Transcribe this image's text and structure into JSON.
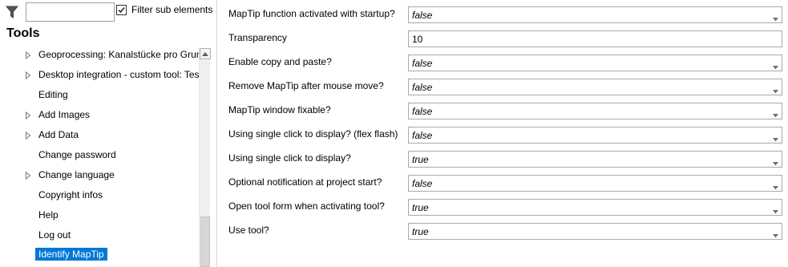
{
  "filter": {
    "input_value": "",
    "checkbox_checked": true,
    "checkbox_label": "Filter sub elements"
  },
  "tools_title": "Tools",
  "tree_items": [
    {
      "label": "Geoprocessing: Kanalstücke pro Grund",
      "expandable": true,
      "selected": false
    },
    {
      "label": "Desktop integration - custom tool: Test",
      "expandable": true,
      "selected": false
    },
    {
      "label": "Editing",
      "expandable": false,
      "selected": false
    },
    {
      "label": "Add Images",
      "expandable": true,
      "selected": false
    },
    {
      "label": "Add Data",
      "expandable": true,
      "selected": false
    },
    {
      "label": "Change password",
      "expandable": false,
      "selected": false
    },
    {
      "label": "Change language",
      "expandable": true,
      "selected": false
    },
    {
      "label": "Copyright infos",
      "expandable": false,
      "selected": false
    },
    {
      "label": "Help",
      "expandable": false,
      "selected": false
    },
    {
      "label": "Log out",
      "expandable": false,
      "selected": false
    },
    {
      "label": "Identify MapTip",
      "expandable": false,
      "selected": true
    }
  ],
  "properties": [
    {
      "label": "MapTip function activated with startup?",
      "value": "false",
      "type": "dropdown"
    },
    {
      "label": "Transparency",
      "value": "10",
      "type": "text"
    },
    {
      "label": "Enable copy and paste?",
      "value": "false",
      "type": "dropdown"
    },
    {
      "label": "Remove MapTip after mouse move?",
      "value": "false",
      "type": "dropdown"
    },
    {
      "label": "MapTip window fixable?",
      "value": "false",
      "type": "dropdown"
    },
    {
      "label": "Using single click to display? (flex flash)",
      "value": "false",
      "type": "dropdown"
    },
    {
      "label": "Using single click to display?",
      "value": "true",
      "type": "dropdown"
    },
    {
      "label": "Optional notification at project start?",
      "value": "false",
      "type": "dropdown"
    },
    {
      "label": "Open tool form when activating tool?",
      "value": "true",
      "type": "dropdown"
    },
    {
      "label": "Use tool?",
      "value": "true",
      "type": "dropdown"
    }
  ],
  "colors": {
    "selection": "#0078d7",
    "border": "#a9a9a9"
  }
}
